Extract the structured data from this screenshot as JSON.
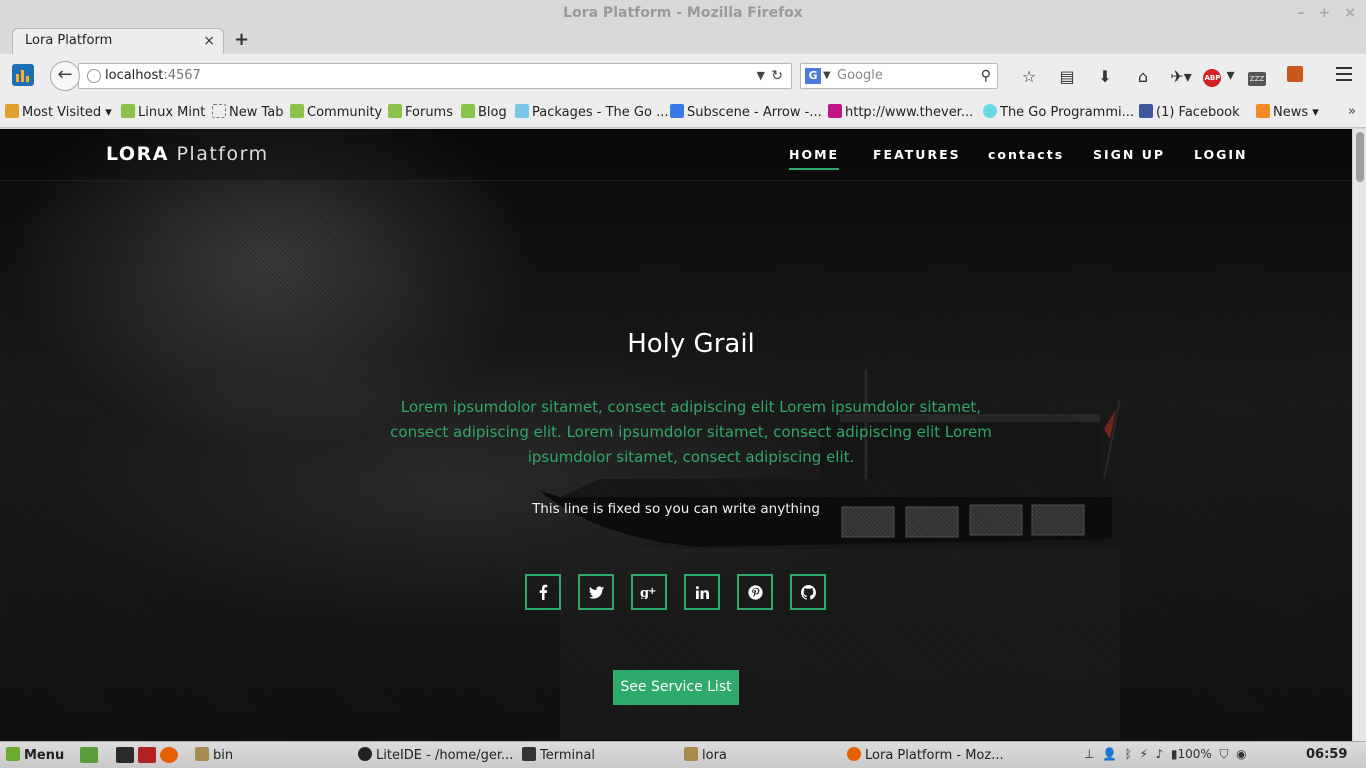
{
  "window": {
    "title": "Lora Platform - Mozilla Firefox",
    "controls": [
      "–",
      "+",
      "×"
    ]
  },
  "tab": {
    "label": "Lora Platform",
    "close": "×",
    "new_tab": "+"
  },
  "address": {
    "host": "localhost",
    "port": ":4567"
  },
  "search": {
    "placeholder": "Google",
    "engine_icon": "G"
  },
  "toolbar_icons": [
    "star-icon",
    "reading-list-icon",
    "download-icon",
    "home-icon",
    "addon-icon",
    "adblock-icon",
    "sleep-icon",
    "firebug-icon",
    "menu-icon"
  ],
  "toolbar_text": {
    "abp": "ABP",
    "zzz": "ZZZ"
  },
  "bookmarks": [
    {
      "label": "Most Visited ▾",
      "icon": "folder"
    },
    {
      "label": "Linux Mint",
      "icon": "mint"
    },
    {
      "label": "New Tab",
      "icon": "blank"
    },
    {
      "label": "Community",
      "icon": "mint"
    },
    {
      "label": "Forums",
      "icon": "mint"
    },
    {
      "label": "Blog",
      "icon": "mint"
    },
    {
      "label": "Packages - The Go ...",
      "icon": "pkg"
    },
    {
      "label": "Subscene - Arrow -...",
      "icon": "goog"
    },
    {
      "label": "http://www.thever...",
      "icon": "verge"
    },
    {
      "label": "The Go Programmi...",
      "icon": "gopher"
    },
    {
      "label": "(1) Facebook",
      "icon": "face"
    },
    {
      "label": "News ▾",
      "icon": "rss"
    }
  ],
  "site": {
    "brand_bold": "LORA",
    "brand_light": "Platform",
    "nav": [
      "HOME",
      "FEATURES",
      "contacts",
      "SIGN UP",
      "LOGIN"
    ],
    "active_nav": "HOME",
    "hero_title": "Holy Grail",
    "hero_text": "Lorem ipsumdolor sitamet, consect adipiscing elit Lorem ipsumdolor sitamet, consect adipiscing elit. Lorem ipsumdolor sitamet, consect adipiscing elit Lorem ipsumdolor sitamet, consect adipiscing elit.",
    "hero_fixed_line": "This line is fixed so you can write anything",
    "social": [
      "facebook-icon",
      "twitter-icon",
      "google-plus-icon",
      "linkedin-icon",
      "pinterest-icon",
      "github-icon"
    ],
    "cta_label": "See Service List",
    "accent_color": "#2eaa6b"
  },
  "taskbar": {
    "menu": "Menu",
    "tasks": [
      "bin",
      "LiteIDE - /home/ger...",
      "Terminal",
      "lora",
      "Lora Platform - Moz..."
    ],
    "battery": "100%",
    "clock": "06:59"
  }
}
